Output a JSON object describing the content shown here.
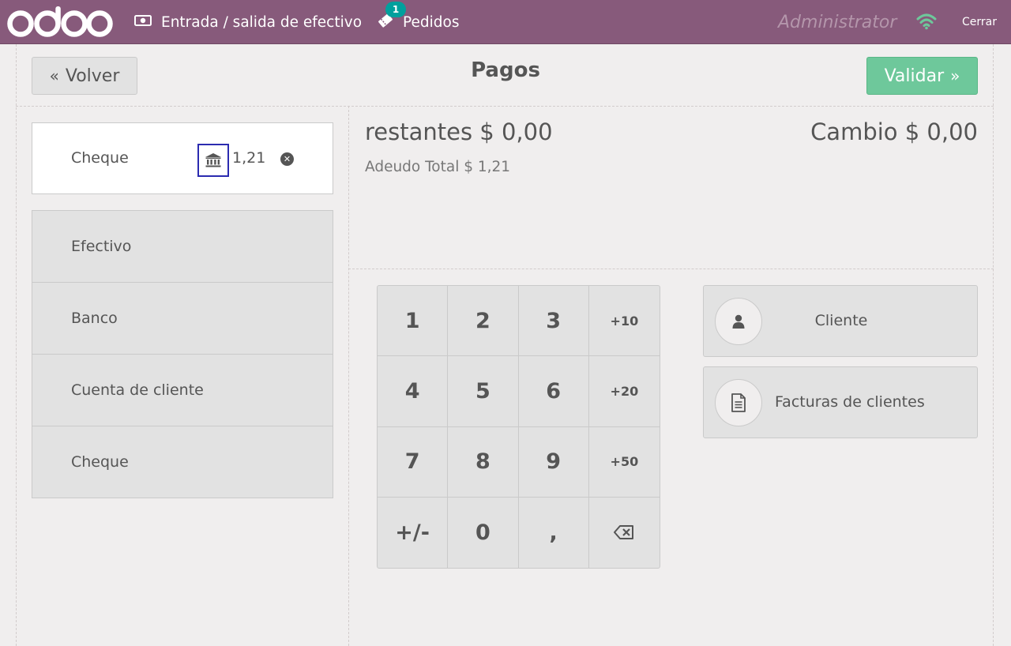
{
  "topbar": {
    "logo_text": "odoo",
    "cash_label": "Entrada / salida de efectivo",
    "orders_label": "Pedidos",
    "orders_badge": "1",
    "user": "Administrator",
    "close_label": "Cerrar",
    "icons": {
      "cash": "money-icon",
      "orders": "ticket-icon",
      "wifi": "wifi-icon"
    }
  },
  "header": {
    "back_label": "Volver",
    "title": "Pagos",
    "validate_label": "Validar"
  },
  "payment_line": {
    "method": "Cheque",
    "amount": "1,21",
    "icon": "bank-icon"
  },
  "payment_methods": [
    "Efectivo",
    "Banco",
    "Cuenta de cliente",
    "Cheque"
  ],
  "summary": {
    "remaining": "restantes $ 0,00",
    "change": "Cambio $ 0,00",
    "total_due": "Adeudo Total  $ 1,21"
  },
  "numpad": {
    "keys": [
      "1",
      "2",
      "3",
      "+10",
      "4",
      "5",
      "6",
      "+20",
      "7",
      "8",
      "9",
      "+50",
      "+/-",
      "0",
      ",",
      "⌫"
    ]
  },
  "actions": {
    "client_label": "Cliente",
    "invoices_label": "Facturas de clientes"
  },
  "colors": {
    "topbar": "#875a7b",
    "validate": "#6ec89b",
    "badge": "#00a09d",
    "wifi": "#6ec89b",
    "highlight_border": "#2b2bb0"
  }
}
